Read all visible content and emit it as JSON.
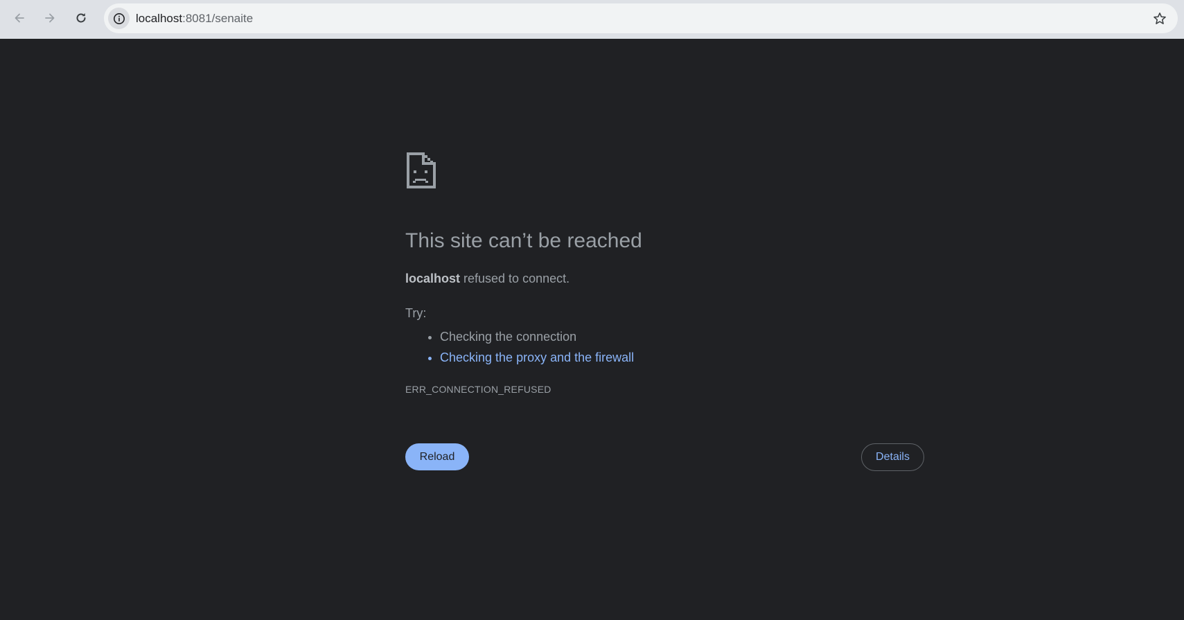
{
  "browser": {
    "url_host": "localhost",
    "url_path": ":8081/senaite",
    "icons": {
      "back": "back-arrow-icon",
      "forward": "forward-arrow-icon",
      "reload": "reload-icon",
      "site_info": "info-icon",
      "bookmark": "star-icon"
    }
  },
  "error_page": {
    "icon": "sad-document-icon",
    "headline": "This site can’t be reached",
    "summary_host": "localhost",
    "summary_text": " refused to connect.",
    "try_label": "Try:",
    "suggestions": [
      {
        "label": "Checking the connection",
        "is_link": false
      },
      {
        "label": "Checking the proxy and the firewall",
        "is_link": true
      }
    ],
    "error_code": "ERR_CONNECTION_REFUSED",
    "reload_label": "Reload",
    "details_label": "Details"
  },
  "colors": {
    "page_background": "#202124",
    "toolbar_background": "#dee1e6",
    "omnibox_background": "#f1f3f4",
    "text_secondary": "#9aa0a6",
    "link": "#8ab4f8",
    "reload_button": "#8ab4f8"
  }
}
